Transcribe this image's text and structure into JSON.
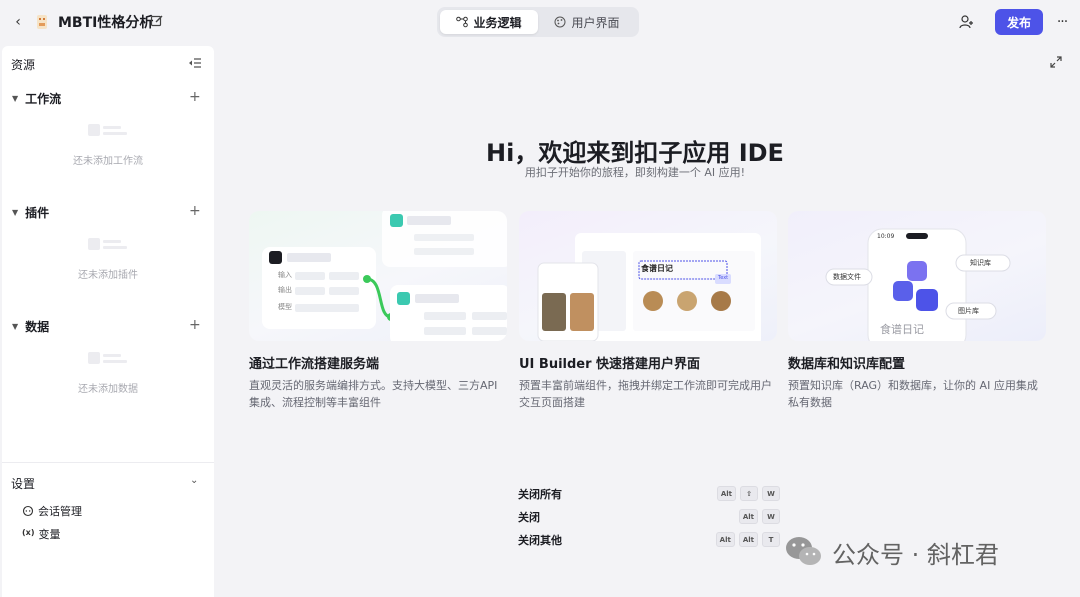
{
  "header": {
    "app_title": "MBTI性格分析",
    "tabs": [
      {
        "label": "业务逻辑",
        "active": true
      },
      {
        "label": "用户界面",
        "active": false
      }
    ],
    "publish_label": "发布"
  },
  "sidebar": {
    "title": "资源",
    "sections": [
      {
        "label": "工作流",
        "empty_text": "还未添加工作流"
      },
      {
        "label": "插件",
        "empty_text": "还未添加插件"
      },
      {
        "label": "数据",
        "empty_text": "还未添加数据"
      }
    ],
    "settings": {
      "label": "设置",
      "items": [
        {
          "label": "会话管理",
          "icon": "chat-icon"
        },
        {
          "label": "变量",
          "icon": "variable-icon",
          "glyph": "(x)"
        }
      ]
    }
  },
  "main": {
    "hero_title": "Hi，欢迎来到扣子应用 IDE",
    "hero_subtitle": "用扣子开始你的旅程，即刻构建一个 AI 应用!",
    "cards": [
      {
        "title": "通过工作流搭建服务端",
        "desc": "直观灵活的服务端编排方式。支持大模型、三方API集成、流程控制等丰富组件",
        "illustration": {
          "label_input": "输入",
          "label_output": "输出",
          "label_model": "模型"
        }
      },
      {
        "title": "UI Builder 快速搭建用户界面",
        "desc": "预置丰富前端组件，拖拽并绑定工作流即可完成用户交互页面搭建",
        "illustration": {
          "recipe_title": "食谱日记",
          "badge": "Text"
        }
      },
      {
        "title": "数据库和知识库配置",
        "desc": "预置知识库（RAG）和数据库，让你的 AI 应用集成私有数据",
        "illustration": {
          "tag_file": "数据文件",
          "tag_kb": "知识库",
          "tag_img": "图片库",
          "phone_text": "食谱日记",
          "time": "10:09"
        }
      }
    ],
    "shortcuts": [
      {
        "label": "关闭所有",
        "keys": [
          "Alt",
          "⇧",
          "W"
        ]
      },
      {
        "label": "关闭",
        "keys": [
          "Alt",
          "W"
        ]
      },
      {
        "label": "关闭其他",
        "keys": [
          "Alt",
          "Alt",
          "T"
        ]
      }
    ]
  },
  "watermark": "公众号 · 斜杠君",
  "colors": {
    "accent": "#4d53e8",
    "background": "#f3f3f6",
    "sidebar": "#ffffff",
    "flow_green": "#3bc95a"
  }
}
